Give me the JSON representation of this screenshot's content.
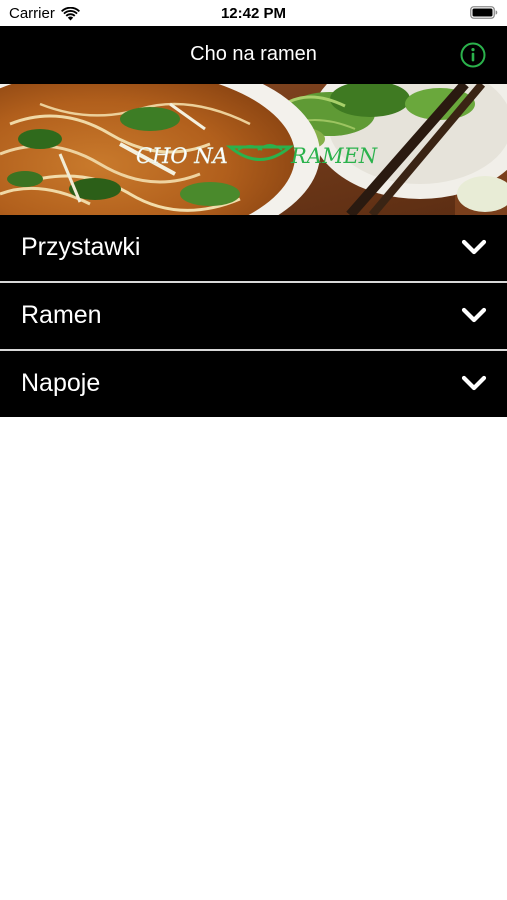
{
  "status_bar": {
    "carrier": "Carrier",
    "time": "12:42 PM",
    "icons": [
      "wifi-icon",
      "battery-icon"
    ]
  },
  "nav": {
    "title": "Cho na ramen",
    "info_icon": "info-icon"
  },
  "banner": {
    "logo_text_left": "CHO NA",
    "logo_text_right": "RAMEN"
  },
  "menu": {
    "items": [
      {
        "label": "Przystawki",
        "icon": "chevron-down-icon"
      },
      {
        "label": "Ramen",
        "icon": "chevron-down-icon"
      },
      {
        "label": "Napoje",
        "icon": "chevron-down-icon"
      }
    ]
  },
  "colors": {
    "accent": "#2bb24c",
    "nav_background": "#000000",
    "row_background": "#000000",
    "separator": "#d8d8d8",
    "text_light": "#ffffff"
  }
}
